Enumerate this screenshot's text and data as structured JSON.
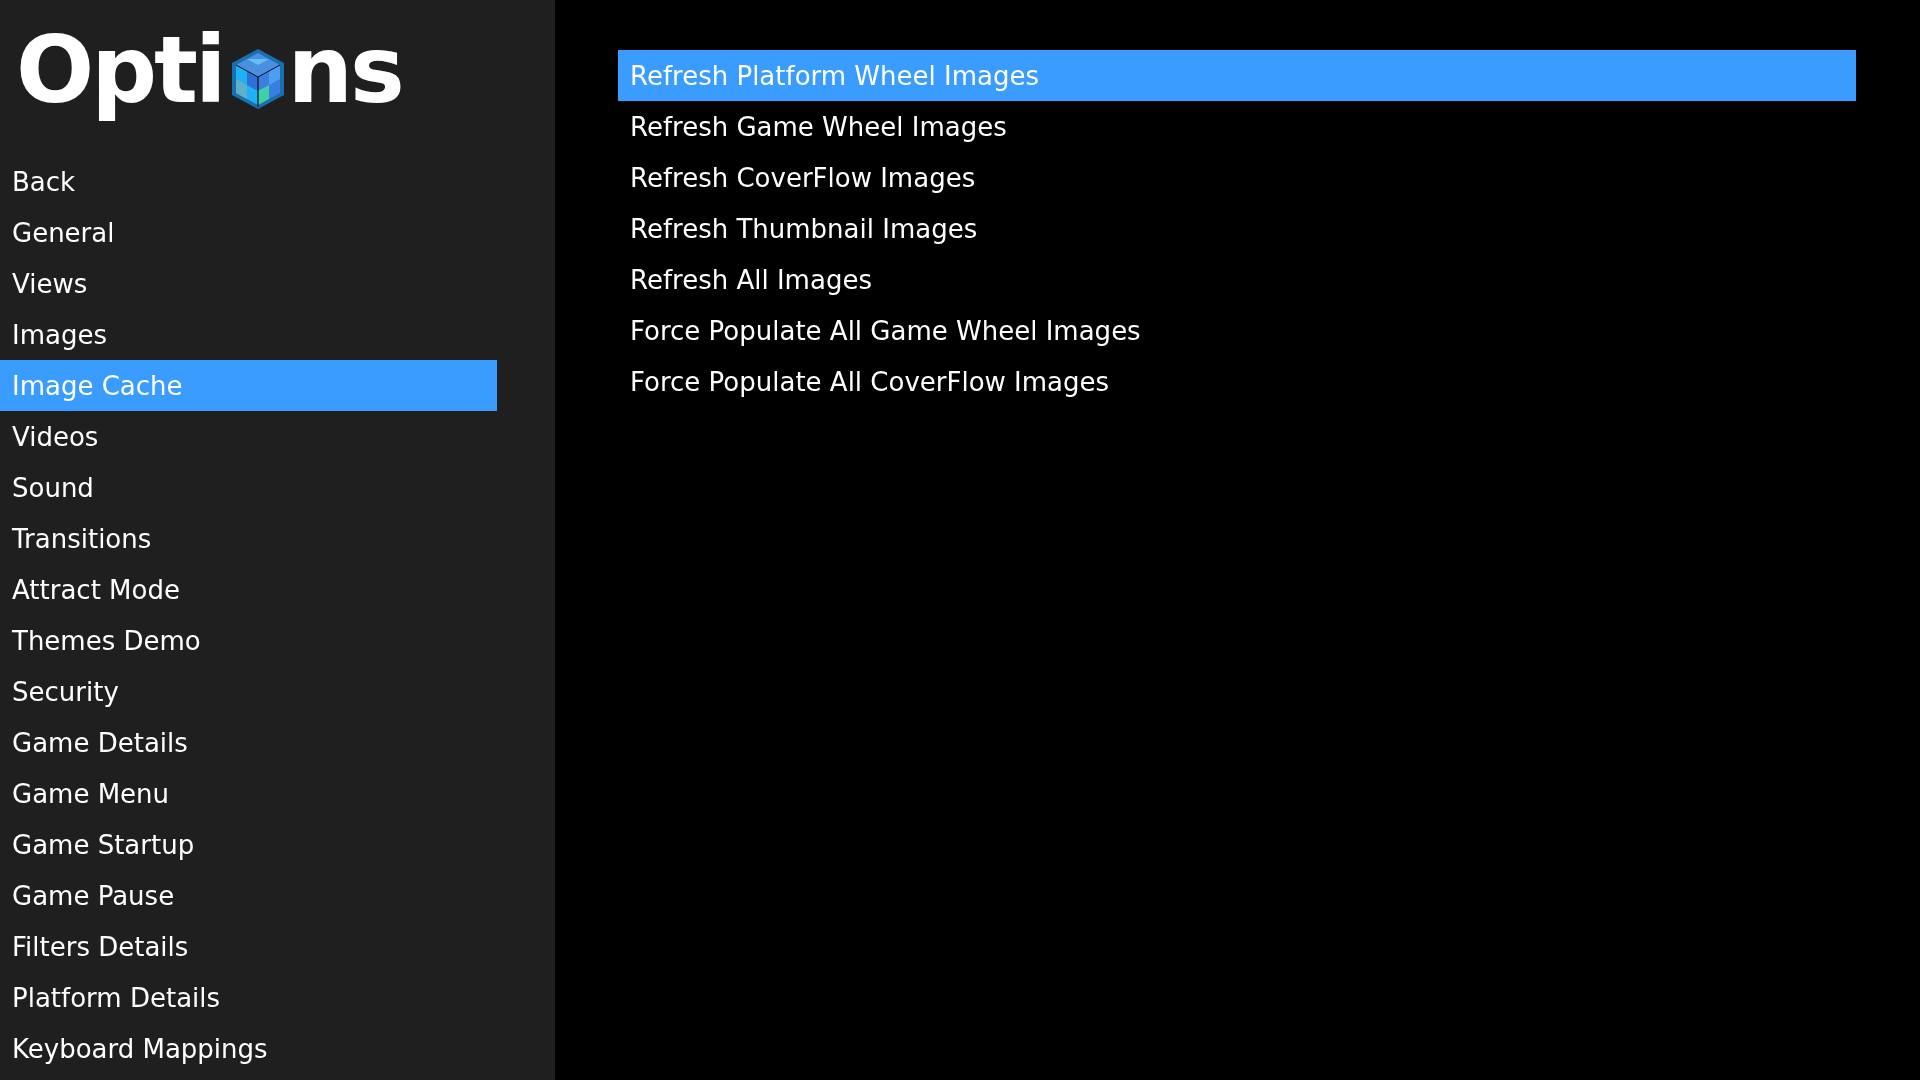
{
  "title": {
    "before_icon": "Opti",
    "after_icon": "ns"
  },
  "sidebar": {
    "items": [
      {
        "label": "Back",
        "selected": false
      },
      {
        "label": "General",
        "selected": false
      },
      {
        "label": "Views",
        "selected": false
      },
      {
        "label": "Images",
        "selected": false
      },
      {
        "label": "Image Cache",
        "selected": true
      },
      {
        "label": "Videos",
        "selected": false
      },
      {
        "label": "Sound",
        "selected": false
      },
      {
        "label": "Transitions",
        "selected": false
      },
      {
        "label": "Attract Mode",
        "selected": false
      },
      {
        "label": "Themes Demo",
        "selected": false
      },
      {
        "label": "Security",
        "selected": false
      },
      {
        "label": "Game Details",
        "selected": false
      },
      {
        "label": "Game Menu",
        "selected": false
      },
      {
        "label": "Game Startup",
        "selected": false
      },
      {
        "label": "Game Pause",
        "selected": false
      },
      {
        "label": "Filters Details",
        "selected": false
      },
      {
        "label": "Platform Details",
        "selected": false
      },
      {
        "label": "Keyboard Mappings",
        "selected": false
      }
    ]
  },
  "actions": [
    {
      "label": "Refresh Platform Wheel Images",
      "selected": true
    },
    {
      "label": "Refresh Game Wheel Images",
      "selected": false
    },
    {
      "label": "Refresh CoverFlow Images",
      "selected": false
    },
    {
      "label": "Refresh Thumbnail Images",
      "selected": false
    },
    {
      "label": "Refresh All Images",
      "selected": false
    },
    {
      "label": "Force Populate All Game Wheel Images",
      "selected": false
    },
    {
      "label": "Force Populate All CoverFlow Images",
      "selected": false
    }
  ]
}
